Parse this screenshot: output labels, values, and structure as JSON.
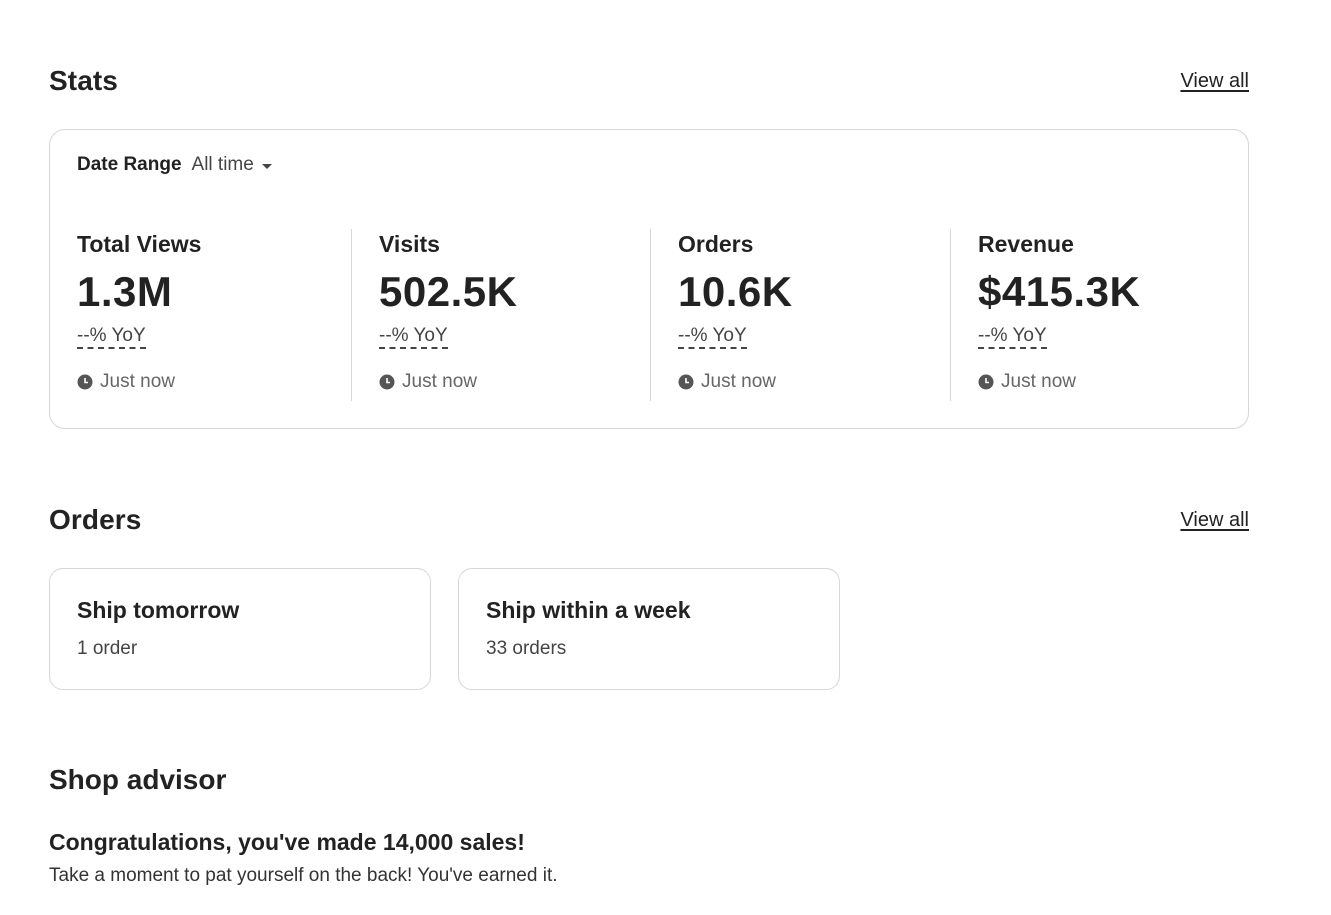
{
  "stats": {
    "title": "Stats",
    "view_all": "View all",
    "date_range_label": "Date Range",
    "date_range_value": "All time",
    "metrics": [
      {
        "label": "Total Views",
        "value": "1.3M",
        "yoy": "--% YoY",
        "updated": "Just now"
      },
      {
        "label": "Visits",
        "value": "502.5K",
        "yoy": "--% YoY",
        "updated": "Just now"
      },
      {
        "label": "Orders",
        "value": "10.6K",
        "yoy": "--% YoY",
        "updated": "Just now"
      },
      {
        "label": "Revenue",
        "value": "$415.3K",
        "yoy": "--% YoY",
        "updated": "Just now"
      }
    ]
  },
  "orders": {
    "title": "Orders",
    "view_all": "View all",
    "cards": [
      {
        "title": "Ship tomorrow",
        "count": "1 order"
      },
      {
        "title": "Ship within a week",
        "count": "33 orders"
      }
    ]
  },
  "advisor": {
    "title": "Shop advisor",
    "headline": "Congratulations, you've made 14,000 sales!",
    "body": "Take a moment to pat yourself on the back! You've earned it."
  },
  "icons": {
    "clock": "clock-icon",
    "caret": "caret-down-icon"
  },
  "colors": {
    "text": "#222222",
    "muted": "#666666",
    "border": "#d6d6d6"
  }
}
